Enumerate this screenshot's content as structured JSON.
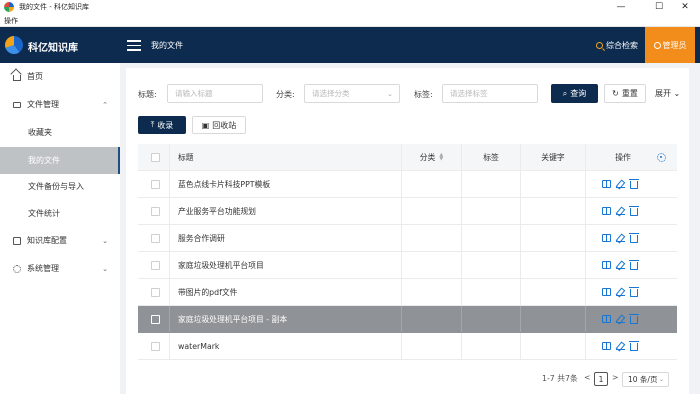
{
  "window": {
    "title": "我的文件 - 科亿知识库",
    "menu": "操作",
    "controls": {
      "minimize": "—",
      "maximize": "☐",
      "close": "✕"
    }
  },
  "header": {
    "brand": "科亿知识库",
    "page_title": "我的文件",
    "search_label": "综合检索",
    "admin_label": "管理员",
    "colors": {
      "bg": "#0c2b4e",
      "accent": "#f28c1a"
    }
  },
  "sidebar": {
    "items": [
      {
        "label": "首页",
        "icon": "home-icon"
      },
      {
        "label": "文件管理",
        "icon": "folder-icon",
        "chevron": "⌃"
      },
      {
        "label": "收藏夹"
      },
      {
        "label": "我的文件",
        "active": true
      },
      {
        "label": "文件备份与导入"
      },
      {
        "label": "文件统计"
      },
      {
        "label": "知识库配置",
        "icon": "kb-icon",
        "chevron": "⌄"
      },
      {
        "label": "系统管理",
        "icon": "gear-icon",
        "chevron": "⌄"
      }
    ]
  },
  "filters": {
    "title_label": "标题:",
    "title_placeholder": "请输入标题",
    "category_label": "分类:",
    "category_placeholder": "请选择分类",
    "tag_label": "标签:",
    "tag_placeholder": "请选择标签",
    "query_button": "查询",
    "reset_button": "重置",
    "expand_button": "展开"
  },
  "actions": {
    "collect_button": "收录",
    "recycle_button": "回收站"
  },
  "table": {
    "columns": [
      "标题",
      "分类",
      "标签",
      "关键字",
      "操作"
    ],
    "rows": [
      {
        "title": "蓝色点线卡片科技PPT模板"
      },
      {
        "title": "产业服务平台功能规划"
      },
      {
        "title": "服务合作调研"
      },
      {
        "title": "家庭垃圾处理机平台项目"
      },
      {
        "title": "带图片的pdf文件"
      },
      {
        "title": "家庭垃圾处理机平台项目 - 副本",
        "selected": true
      },
      {
        "title": "waterMark"
      }
    ]
  },
  "pagination": {
    "summary": "1-7 共7条",
    "prev": "<",
    "current_page": "1",
    "next": ">",
    "page_size": "10 条/页"
  }
}
